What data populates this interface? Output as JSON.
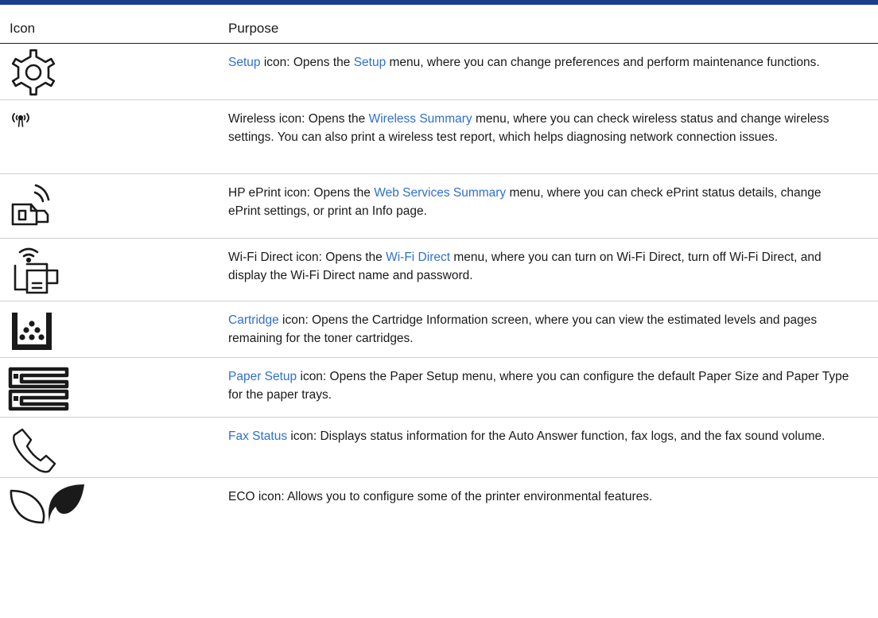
{
  "colors": {
    "rule": "#1a3e8c",
    "link": "#2f6fd1",
    "text": "#1a1a1a"
  },
  "header": {
    "icon_label": "Icon",
    "purpose_label": "Purpose"
  },
  "rows": [
    {
      "icon": "gear-icon",
      "parts": [
        "",
        "Setup",
        " icon: Opens the ",
        "Setup",
        " menu, where you can change preferences and perform maintenance functions."
      ]
    },
    {
      "icon": "wireless-icon",
      "parts": [
        "Wireless icon: Opens the ",
        "Wireless Summary",
        " menu, where you can check wireless status and change wireless settings. You can also print a wireless test report, which helps diagnosing network connection issues."
      ]
    },
    {
      "icon": "eprint-icon",
      "parts": [
        "HP ePrint icon: Opens the ",
        "Web Services Summary",
        " menu, where you can check ePrint status details, change ePrint settings, or print an Info page."
      ]
    },
    {
      "icon": "wifi-direct-icon",
      "parts": [
        "Wi-Fi Direct icon: Opens the ",
        "Wi-Fi Direct",
        " menu, where you can turn on Wi-Fi Direct, turn off Wi-Fi Direct, and display the Wi-Fi Direct name and password."
      ]
    },
    {
      "icon": "cartridge-icon",
      "parts": [
        "",
        "Cartridge",
        " icon: Opens the Cartridge Information screen, where you can view the estimated levels and pages remaining for the toner cartridges."
      ]
    },
    {
      "icon": "paper-setup-icon",
      "parts": [
        "",
        "Paper Setup",
        " icon: Opens the Paper Setup menu, where you can configure the default Paper Size and Paper Type for the paper trays."
      ]
    },
    {
      "icon": "phone-icon",
      "parts": [
        "",
        "Fax Status",
        " icon: Displays status information for the Auto Answer function, fax logs, and the fax sound volume."
      ]
    },
    {
      "icon": "eco-leaf-icon",
      "parts": [
        "ECO icon: Allows you to configure some of the printer environmental features."
      ]
    }
  ]
}
